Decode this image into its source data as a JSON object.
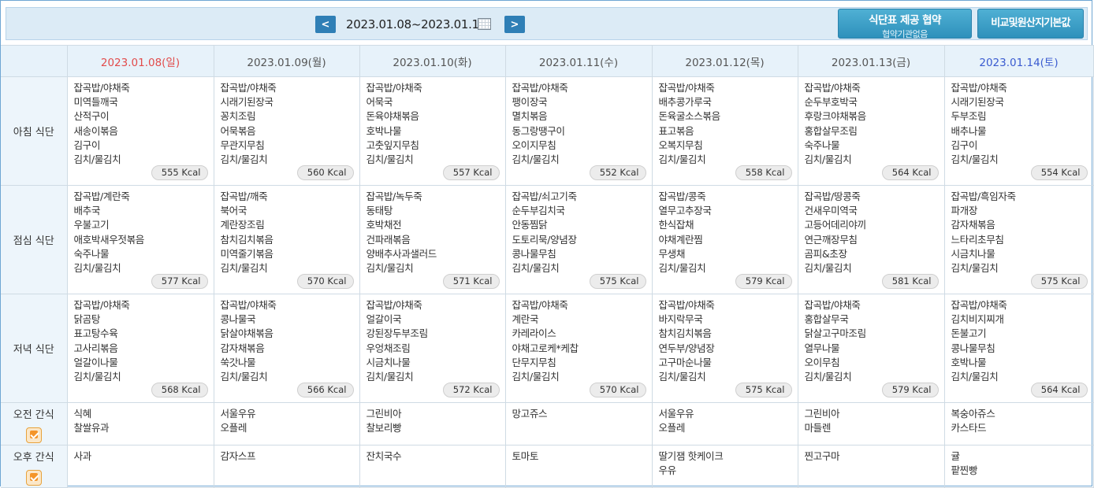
{
  "nav": {
    "prev": "<",
    "next": ">",
    "date_range": "2023.01.08~2023.01.14"
  },
  "buttons": {
    "provide_line1": "식단표 제공 협약",
    "provide_line2": "협약기관없음",
    "compare": "비교및원산지기본값"
  },
  "days": [
    "2023.01.08(일)",
    "2023.01.09(월)",
    "2023.01.10(화)",
    "2023.01.11(수)",
    "2023.01.12(목)",
    "2023.01.13(금)",
    "2023.01.14(토)"
  ],
  "rows": [
    {
      "label": "아침 식단",
      "cells": [
        {
          "items": [
            "잡곡밥/야채죽",
            "미역들깨국",
            "산적구이",
            "새송이볶음",
            "김구이",
            "김치/물김치"
          ],
          "kcal": "555 Kcal"
        },
        {
          "items": [
            "잡곡밥/야채죽",
            "시래기된장국",
            "꽁치조림",
            "어묵볶음",
            "무관지무침",
            "김치/물김치"
          ],
          "kcal": "560 Kcal"
        },
        {
          "items": [
            "잡곡밥/야채죽",
            "어묵국",
            "돈육야채볶음",
            "호박나물",
            "고춧잎지무침",
            "김치/물김치"
          ],
          "kcal": "557 Kcal"
        },
        {
          "items": [
            "잡곡밥/야채죽",
            "팽이장국",
            "멸치볶음",
            "동그랑땡구이",
            "오이지무침",
            "김치/물김치"
          ],
          "kcal": "552 Kcal"
        },
        {
          "items": [
            "잡곡밥/야채죽",
            "배추콩가루국",
            "돈육굴소스볶음",
            "표고볶음",
            "오복지무침",
            "김치/물김치"
          ],
          "kcal": "558 Kcal"
        },
        {
          "items": [
            "잡곡밥/야채죽",
            "순두부호박국",
            "후랑크야채볶음",
            "홍합살무조림",
            "숙주나물",
            "김치/물김치"
          ],
          "kcal": "564 Kcal"
        },
        {
          "items": [
            "잡곡밥/야채죽",
            "시래기된장국",
            "두부조림",
            "배추나물",
            "김구이",
            "김치/물김치"
          ],
          "kcal": "554 Kcal"
        }
      ]
    },
    {
      "label": "점심 식단",
      "cells": [
        {
          "items": [
            "잡곡밥/계란죽",
            "배추국",
            "우불고기",
            "애호박새우젓볶음",
            "숙주나물",
            "김치/물김치"
          ],
          "kcal": "577 Kcal"
        },
        {
          "items": [
            "잡곡밥/깨죽",
            "북어국",
            "계란장조림",
            "참치김치볶음",
            "미역줄기볶음",
            "김치/물김치"
          ],
          "kcal": "570 Kcal"
        },
        {
          "items": [
            "잡곡밥/녹두죽",
            "동태탕",
            "호박채전",
            "건파래볶음",
            "양배추사과샐러드",
            "김치/물김치"
          ],
          "kcal": "571 Kcal"
        },
        {
          "items": [
            "잡곡밥/쇠고기죽",
            "순두부김치국",
            "안동찜닭",
            "도토리묵/양념장",
            "콩나물무침",
            "김치/물김치"
          ],
          "kcal": "575 Kcal"
        },
        {
          "items": [
            "잡곡밥/콩죽",
            "열무고추장국",
            "한식잡채",
            "야채계란찜",
            "무생채",
            "김치/물김치"
          ],
          "kcal": "579 Kcal"
        },
        {
          "items": [
            "잡곡밥/땅콩죽",
            "건새우미역국",
            "고등어데리야끼",
            "연근깨장무침",
            "곰피&초장",
            "김치/물김치"
          ],
          "kcal": "581 Kcal"
        },
        {
          "items": [
            "잡곡밥/흑임자죽",
            "파개장",
            "감자채볶음",
            "느타리초무침",
            "시금치나물",
            "김치/물김치"
          ],
          "kcal": "575 Kcal"
        }
      ]
    },
    {
      "label": "저녁 식단",
      "cells": [
        {
          "items": [
            "잡곡밥/야채죽",
            "닭곰탕",
            "표고탕수육",
            "고사리볶음",
            "얼갈이나물",
            "김치/물김치"
          ],
          "kcal": "568 Kcal"
        },
        {
          "items": [
            "잡곡밥/야채죽",
            "콩나물국",
            "닭살야채볶음",
            "감자채볶음",
            "쑥갓나물",
            "김치/물김치"
          ],
          "kcal": "566 Kcal"
        },
        {
          "items": [
            "잡곡밥/야채죽",
            "얼갈이국",
            "강된장두부조림",
            "우엉채조림",
            "시금치나물",
            "김치/물김치"
          ],
          "kcal": "572 Kcal"
        },
        {
          "items": [
            "잡곡밥/야채죽",
            "계란국",
            "카레라이스",
            "야채고로케*케찹",
            "단무지무침",
            "김치/물김치"
          ],
          "kcal": "570 Kcal"
        },
        {
          "items": [
            "잡곡밥/야채죽",
            "바지락무국",
            "참치김치볶음",
            "연두부/양념장",
            "고구마순나물",
            "김치/물김치"
          ],
          "kcal": "575 Kcal"
        },
        {
          "items": [
            "잡곡밥/야채죽",
            "홍합살무국",
            "닭살고구마조림",
            "열무나물",
            "오이무침",
            "김치/물김치"
          ],
          "kcal": "579 Kcal"
        },
        {
          "items": [
            "잡곡밥/야채죽",
            "김치비지찌개",
            "돈불고기",
            "콩나물무침",
            "호박나물",
            "김치/물김치"
          ],
          "kcal": "564 Kcal"
        }
      ]
    }
  ],
  "snacks": [
    {
      "label": "오전 간식",
      "cells": [
        [
          "식혜",
          "찰쌀유과"
        ],
        [
          "서울우유",
          "오플레"
        ],
        [
          "그린비아",
          "찰보리빵"
        ],
        [
          "망고쥬스"
        ],
        [
          "서울우유",
          "오플레"
        ],
        [
          "그린비아",
          "마들렌"
        ],
        [
          "복숭아쥬스",
          "카스타드"
        ]
      ]
    },
    {
      "label": "오후 간식",
      "cells": [
        [
          "사과"
        ],
        [
          "감자스프"
        ],
        [
          "잔치국수"
        ],
        [
          "토마토"
        ],
        [
          "딸기잼 핫케이크",
          "우유"
        ],
        [
          "찐고구마"
        ],
        [
          "귤",
          "팥찐빵"
        ]
      ]
    }
  ],
  "icons": {
    "prev": "chevron-left-icon",
    "next": "chevron-right-icon",
    "calendar": "calendar-icon",
    "check": "checkbox-icon"
  },
  "colors": {
    "sunday": "#e24b4b",
    "saturday": "#3a5bd0",
    "button": "#3a9cc6",
    "header_bg": "#e7f2fa"
  }
}
